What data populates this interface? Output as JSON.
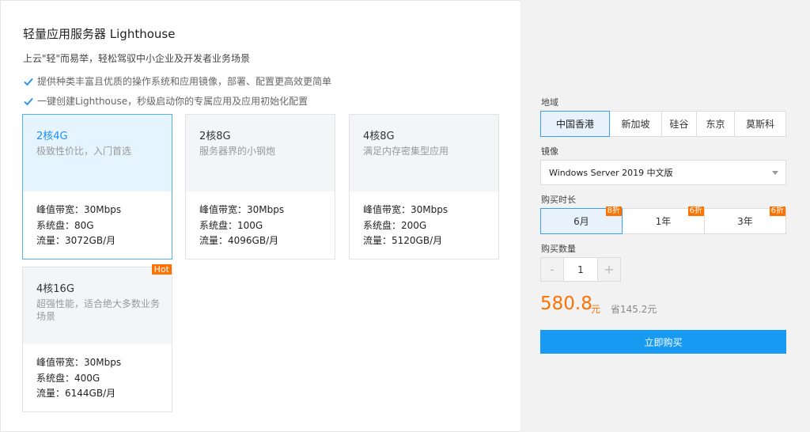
{
  "header": {
    "title": "轻量应用服务器 Lighthouse",
    "subtitle": "上云\"轻\"而易举，轻松驾驭中小企业及开发者业务场景",
    "features": [
      "提供种类丰富且优质的操作系统和应用镜像，部署、配置更高效更简单",
      "一键创建Lighthouse，秒级启动你的专属应用及应用初始化配置"
    ]
  },
  "plans": [
    {
      "name": "2核4G",
      "desc": "极致性价比，入门首选",
      "bandwidth": "峰值带宽：30Mbps",
      "disk": "系统盘：80G",
      "traffic": "流量：3072GB/月",
      "badge": ""
    },
    {
      "name": "2核8G",
      "desc": "服务器界的小钢炮",
      "bandwidth": "峰值带宽：30Mbps",
      "disk": "系统盘：100G",
      "traffic": "流量：4096GB/月",
      "badge": ""
    },
    {
      "name": "4核8G",
      "desc": "满足内存密集型应用",
      "bandwidth": "峰值带宽：30Mbps",
      "disk": "系统盘：200G",
      "traffic": "流量：5120GB/月",
      "badge": ""
    },
    {
      "name": "4核16G",
      "desc": "超强性能，适合绝大多数业务场景",
      "bandwidth": "峰值带宽：30Mbps",
      "disk": "系统盘：400G",
      "traffic": "流量：6144GB/月",
      "badge": "Hot"
    }
  ],
  "order": {
    "region_label": "地域",
    "regions": [
      "中国香港",
      "新加坡",
      "硅谷",
      "东京",
      "莫斯科"
    ],
    "image_label": "镜像",
    "image_value": "Windows Server 2019 中文版",
    "duration_label": "购买时长",
    "durations": [
      {
        "label": "6月",
        "discount": "8折"
      },
      {
        "label": "1年",
        "discount": "6折"
      },
      {
        "label": "3年",
        "discount": "6折"
      }
    ],
    "quantity_label": "购买数量",
    "quantity_minus": "-",
    "quantity_value": "1",
    "quantity_plus": "+",
    "price": "580.8",
    "price_unit": "元",
    "saving": "省145.2元",
    "buy_label": "立即购买"
  },
  "colors": {
    "accent": "#179af2",
    "orange": "#ff7200",
    "selected_bg": "#e5f4ff"
  }
}
